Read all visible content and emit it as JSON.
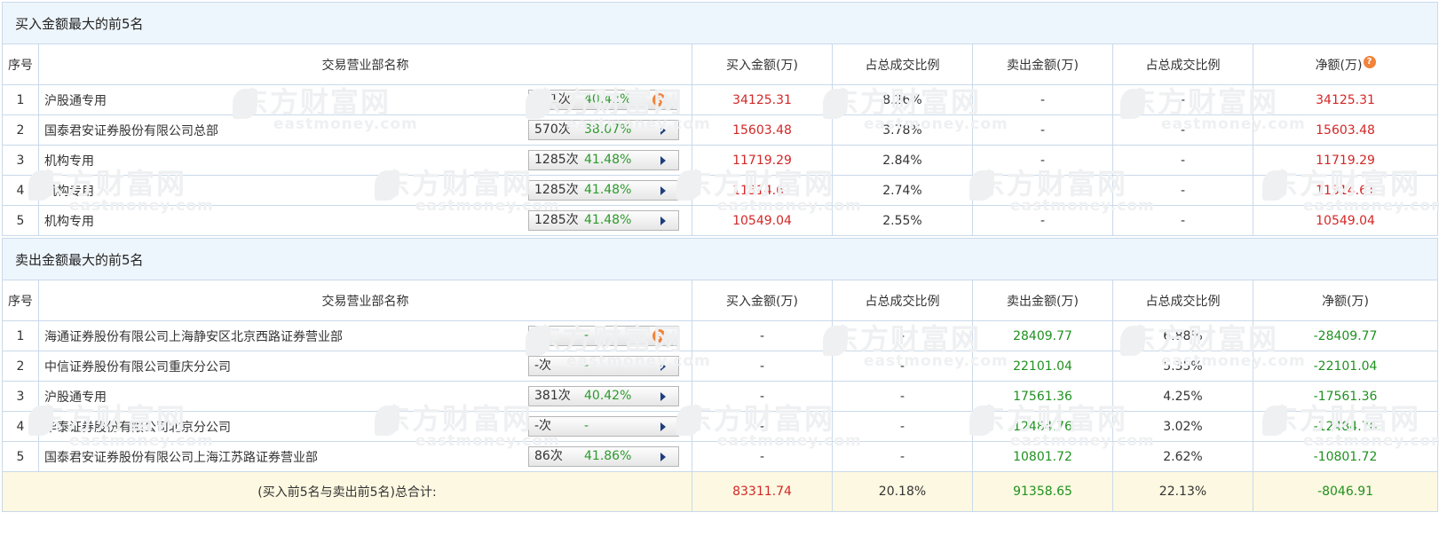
{
  "columns": {
    "seq": "序号",
    "name": "交易营业部名称",
    "buy_amount": "买入金额(万)",
    "buy_ratio": "占总成交比例",
    "sell_amount": "卖出金额(万)",
    "sell_ratio": "占总成交比例",
    "net": "净额(万)"
  },
  "buy_section": {
    "title": "买入金额最大的前5名",
    "rows": [
      {
        "seq": "1",
        "name": "沪股通专用",
        "count": "381次",
        "rate": "40.42%",
        "buy": "34125.31",
        "buy_ratio": "8.26%",
        "sell": "-",
        "sell_ratio": "-",
        "net": "34125.31",
        "icon": "question-icon"
      },
      {
        "seq": "2",
        "name": "国泰君安证券股份有限公司总部",
        "count": "570次",
        "rate": "38.07%",
        "buy": "15603.48",
        "buy_ratio": "3.78%",
        "sell": "-",
        "sell_ratio": "-",
        "net": "15603.48",
        "icon": "play-arrow-icon"
      },
      {
        "seq": "3",
        "name": "机构专用",
        "count": "1285次",
        "rate": "41.48%",
        "buy": "11719.29",
        "buy_ratio": "2.84%",
        "sell": "-",
        "sell_ratio": "-",
        "net": "11719.29",
        "icon": "play-arrow-icon"
      },
      {
        "seq": "4",
        "name": "机构专用",
        "count": "1285次",
        "rate": "41.48%",
        "buy": "11314.61",
        "buy_ratio": "2.74%",
        "sell": "-",
        "sell_ratio": "-",
        "net": "11314.61",
        "icon": "play-arrow-icon"
      },
      {
        "seq": "5",
        "name": "机构专用",
        "count": "1285次",
        "rate": "41.48%",
        "buy": "10549.04",
        "buy_ratio": "2.55%",
        "sell": "-",
        "sell_ratio": "-",
        "net": "10549.04",
        "icon": "play-arrow-icon"
      }
    ]
  },
  "sell_section": {
    "title": "卖出金额最大的前5名",
    "rows": [
      {
        "seq": "1",
        "name": "海通证券股份有限公司上海静安区北京西路证券营业部",
        "count": "-次",
        "rate": "-",
        "buy": "-",
        "buy_ratio": "-",
        "sell": "28409.77",
        "sell_ratio": "6.88%",
        "net": "-28409.77",
        "icon": "question-icon"
      },
      {
        "seq": "2",
        "name": "中信证券股份有限公司重庆分公司",
        "count": "-次",
        "rate": "-",
        "buy": "-",
        "buy_ratio": "-",
        "sell": "22101.04",
        "sell_ratio": "5.35%",
        "net": "-22101.04",
        "icon": "play-arrow-icon"
      },
      {
        "seq": "3",
        "name": "沪股通专用",
        "count": "381次",
        "rate": "40.42%",
        "buy": "-",
        "buy_ratio": "-",
        "sell": "17561.36",
        "sell_ratio": "4.25%",
        "net": "-17561.36",
        "icon": "play-arrow-icon"
      },
      {
        "seq": "4",
        "name": "华泰证券股份有限公司北京分公司",
        "count": "-次",
        "rate": "-",
        "buy": "-",
        "buy_ratio": "-",
        "sell": "12484.76",
        "sell_ratio": "3.02%",
        "net": "-12484.76",
        "icon": "play-arrow-icon"
      },
      {
        "seq": "5",
        "name": "国泰君安证券股份有限公司上海江苏路证券营业部",
        "count": "86次",
        "rate": "41.86%",
        "buy": "-",
        "buy_ratio": "-",
        "sell": "10801.72",
        "sell_ratio": "2.62%",
        "net": "-10801.72",
        "icon": "play-arrow-icon"
      }
    ]
  },
  "total": {
    "label": "(买入前5名与卖出前5名)总合计:",
    "buy": "83311.74",
    "buy_ratio": "20.18%",
    "sell": "91358.65",
    "sell_ratio": "22.13%",
    "net": "-8046.91"
  },
  "help_glyph": "?",
  "watermark": {
    "cn": "东方财富网",
    "en": "eastmoney.com"
  },
  "colors": {
    "positive": "#d32727",
    "negative": "#209120",
    "header_bg": "#eef6fd",
    "total_bg": "#fdf8e1",
    "border": "#c9d9ea"
  }
}
